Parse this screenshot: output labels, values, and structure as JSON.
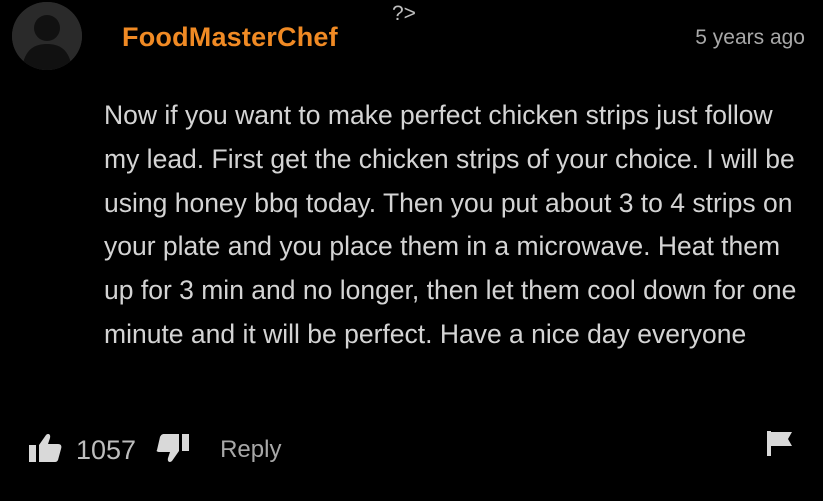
{
  "comment": {
    "username": "FoodMasterChef",
    "stray_text": "?>",
    "timestamp": "5 years ago",
    "body": "Now if you want to make perfect chicken strips just follow my lead. First get the chicken strips of your choice. I will be using honey bbq today. Then you put about 3 to 4 strips on your plate and you place them in a microwave. Heat them up for 3 min and no longer, then let them cool down for one minute and it will be perfect. Have a nice day everyone",
    "like_count": "1057",
    "reply_label": "Reply"
  },
  "icons": {
    "avatar": "default-user-avatar-icon",
    "like": "thumbs-up-icon",
    "dislike": "thumbs-down-icon",
    "flag": "flag-icon"
  },
  "colors": {
    "background": "#000000",
    "username": "#f08a24",
    "text": "#d4d4d4",
    "muted": "#a8a8a8"
  }
}
